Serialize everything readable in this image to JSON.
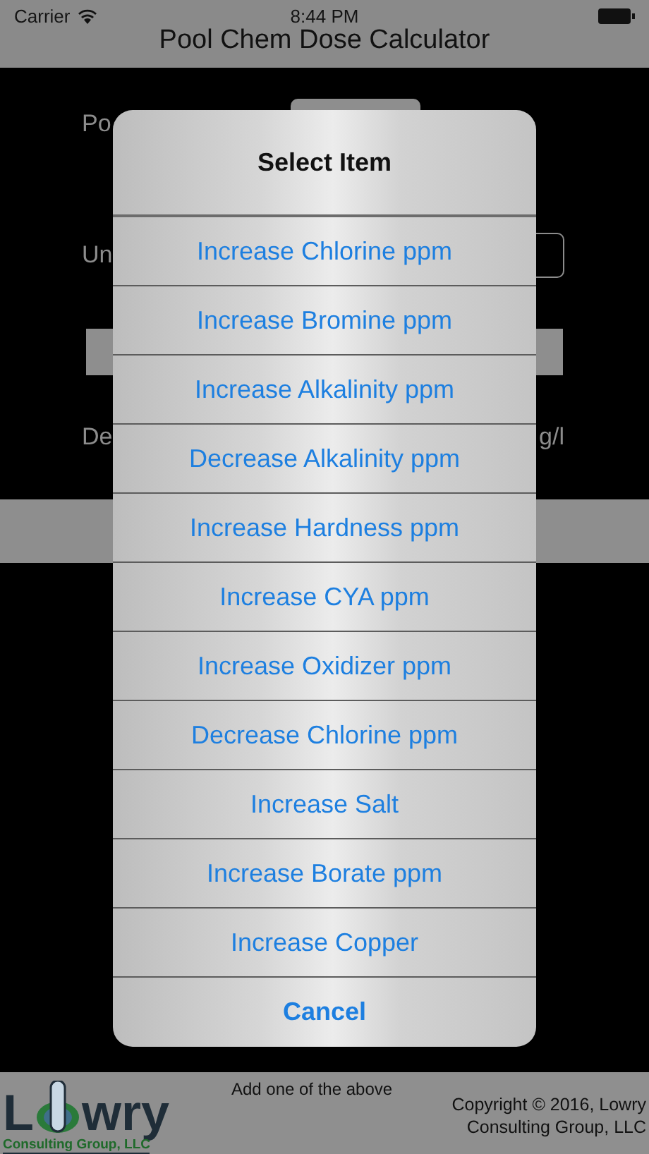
{
  "status_bar": {
    "carrier": "Carrier",
    "time": "8:44 PM"
  },
  "nav": {
    "title": "Pool Chem Dose Calculator"
  },
  "form": {
    "pool_label": "Po",
    "units_label": "Un",
    "dose_label": "De",
    "dose_unit": "g/l"
  },
  "dialog": {
    "title": "Select Item",
    "options": [
      "Increase Chlorine ppm",
      "Increase Bromine ppm",
      "Increase Alkalinity ppm",
      "Decrease Alkalinity ppm",
      "Increase Hardness ppm",
      "Increase CYA ppm",
      "Increase Oxidizer ppm",
      "Decrease Chlorine ppm",
      "Increase Salt",
      "Increase Borate ppm",
      "Increase Copper"
    ],
    "cancel": "Cancel"
  },
  "footer": {
    "logo_left": "L",
    "logo_right": "wry",
    "logo_tagline": "Consulting Group, LLC",
    "hint": "Add one of the above",
    "copyright": "Copyright © 2016, Lowry Consulting Group, LLC"
  }
}
